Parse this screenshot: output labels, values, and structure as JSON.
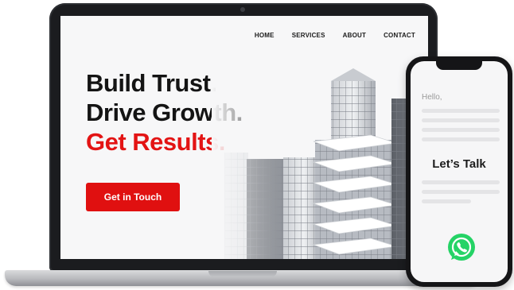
{
  "nav": {
    "items": [
      "HOME",
      "SERVICES",
      "ABOUT",
      "CONTACT"
    ]
  },
  "hero": {
    "line1": "Build Trust.",
    "line2": "Drive Growth.",
    "line3": "Get Results.",
    "cta_label": "Get in Touch"
  },
  "phone": {
    "greeting": "Hello,",
    "title": "Let’s Talk",
    "action_icon": "whatsapp-icon"
  },
  "colors": {
    "accent_red": "#e01010",
    "whatsapp_green": "#25d366",
    "device_frame": "#1b1c1f"
  }
}
